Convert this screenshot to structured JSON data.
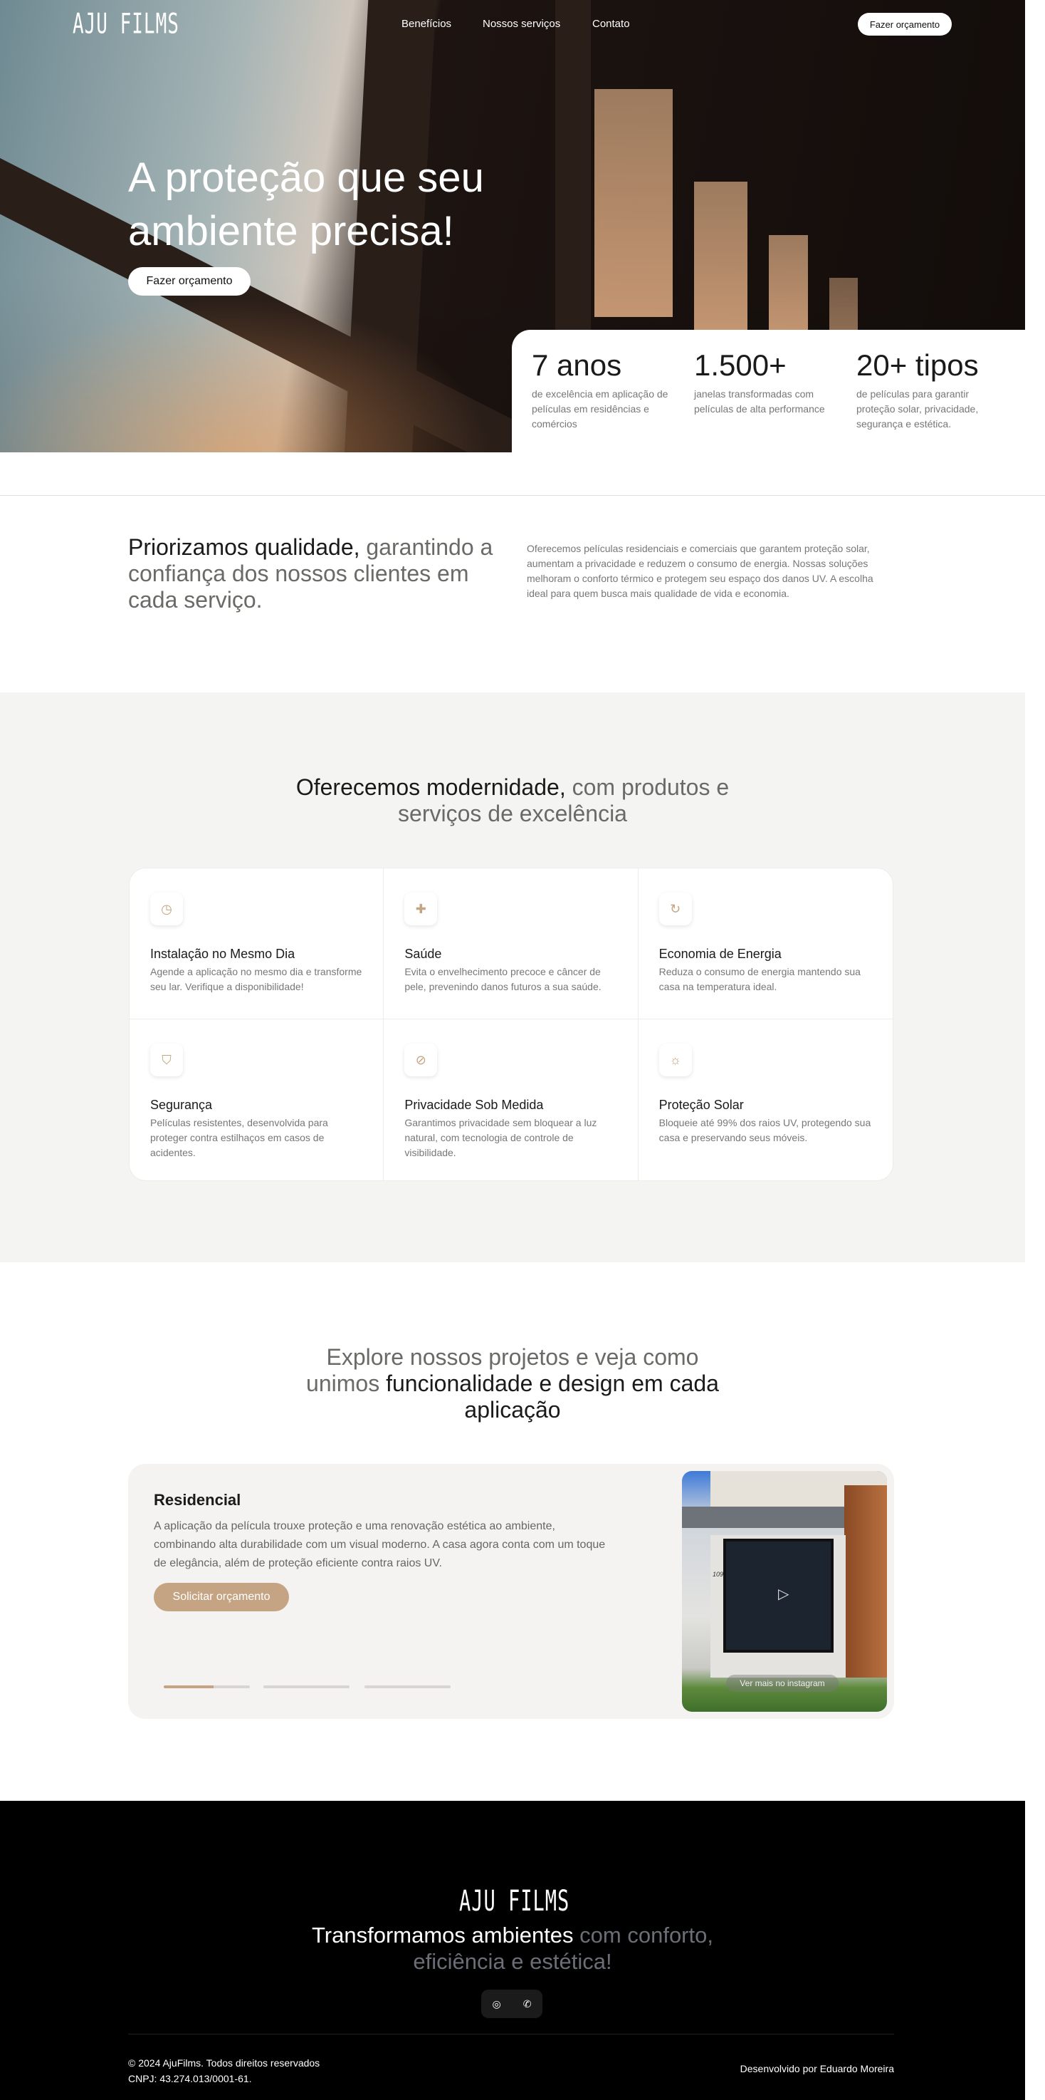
{
  "nav": {
    "logo": "AJU FILMS",
    "links": [
      "Benefícios",
      "Nossos serviços",
      "Contato"
    ],
    "cta": "Fazer orçamento"
  },
  "hero": {
    "title": "A proteção que seu ambiente precisa!",
    "cta": "Fazer orçamento",
    "stats": [
      {
        "value": "7 anos",
        "desc": "de excelência em aplicação de películas em residências e comércios"
      },
      {
        "value": "1.500+",
        "desc": "janelas transformadas com películas de alta performance"
      },
      {
        "value": "20+ tipos",
        "desc": "de películas para garantir proteção solar, privacidade, segurança e estética."
      }
    ]
  },
  "quality": {
    "title_strong": "Priorizamos qualidade,",
    "title_rest": " garantindo a confiança dos nossos clientes em cada serviço.",
    "text": "Oferecemos películas residenciais e comerciais que garantem proteção solar, aumentam a privacidade e reduzem o consumo de energia. Nossas soluções melhoram o conforto térmico e protegem seu espaço dos danos UV. A escolha ideal para quem busca mais qualidade de vida e economia."
  },
  "benefits": {
    "title_strong": "Oferecemos modernidade,",
    "title_rest": " com produtos e serviços de excelência",
    "accent": "#c4a482",
    "items": [
      {
        "icon": "clock-history-icon",
        "title": "Instalação no Mesmo Dia",
        "desc": "Agende a aplicação no mesmo dia e transforme seu lar. Verifique a disponibilidade!"
      },
      {
        "icon": "health-cross-icon",
        "title": "Saúde",
        "desc": "Evita o envelhecimento precoce e câncer de pele, prevenindo danos futuros a sua saúde."
      },
      {
        "icon": "energy-cycle-icon",
        "title": "Economia de Energia",
        "desc": "Reduza o consumo de energia mantendo sua casa na temperatura ideal."
      },
      {
        "icon": "shield-check-icon",
        "title": "Segurança",
        "desc": "Películas resistentes, desenvolvida para proteger contra estilhaços em casos de acidentes."
      },
      {
        "icon": "eye-off-icon",
        "title": "Privacidade Sob Medida",
        "desc": "Garantimos privacidade sem bloquear a luz natural, com tecnologia de controle de visibilidade."
      },
      {
        "icon": "sun-icon",
        "title": "Proteção Solar",
        "desc": "Bloqueie até 99% dos raios UV, protegendo sua casa e preservando seus móveis."
      }
    ]
  },
  "projects": {
    "title_light": "Explore nossos projetos e veja como unimos ",
    "title_strong": "funcionalidade e design em cada aplicação",
    "card": {
      "title": "Residencial",
      "text": "A aplicação da película trouxe proteção e uma renovação estética ao ambiente, combinando alta durabilidade com um visual moderno. A casa agora conta com um toque de elegância, além de proteção eficiente contra raios UV.",
      "cta": "Solicitar orçamento",
      "instagram": "Ver mais no instagram",
      "house_number": "109",
      "progress": [
        0.58,
        0,
        0
      ]
    }
  },
  "footer": {
    "logo": "AJU FILMS",
    "tag_strong": "Transformamos ambientes",
    "tag_rest": " com conforto, eficiência e estética!",
    "socials": [
      "instagram-icon",
      "whatsapp-icon"
    ],
    "copyright": "© 2024 AjuFilms. Todos direitos reservados",
    "cnpj": "CNPJ: 43.274.013/0001-61.",
    "dev_prefix": "Desenvolvido por ",
    "dev_name": "Eduardo Moreira"
  }
}
